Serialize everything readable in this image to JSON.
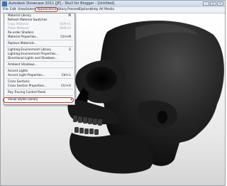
{
  "window": {
    "title": "Autodesk Showcase 2011 [JP] - Skull for Blogger - [Untitled]",
    "minimize": "–",
    "maximize": "□",
    "close": "×"
  },
  "menubar": {
    "items": [
      "File",
      "Edit",
      "View",
      "Select",
      "Appearances",
      "Story",
      "Present",
      "Options",
      "Help",
      "All Media"
    ],
    "active": "Appearances"
  },
  "dropdown": {
    "items": [
      {
        "label": "Material Library",
        "shortcut": "M",
        "disabled": false
      },
      {
        "label": "Refresh Material Swatches",
        "shortcut": "",
        "disabled": false
      },
      {
        "label": "Copy Material",
        "shortcut": "Shift+C",
        "disabled": true
      },
      {
        "label": "Paste Material",
        "shortcut": "Shift+V",
        "disabled": true
      },
      {
        "label": "Re-order Shaders",
        "shortcut": "",
        "disabled": false
      },
      {
        "label": "Material Properties...",
        "shortcut": "Ctrl+M",
        "disabled": false
      },
      {
        "label": "Replace Materials...",
        "shortcut": "",
        "disabled": false
      },
      {
        "label": "Lighting Environment Library",
        "shortcut": "E",
        "disabled": false
      },
      {
        "label": "Lighting Environment Properties...",
        "shortcut": "",
        "disabled": false
      },
      {
        "label": "Directional Lights and Shadows...",
        "shortcut": "",
        "disabled": false
      },
      {
        "label": "Ambient Shadows...",
        "shortcut": "",
        "disabled": false
      },
      {
        "label": "Accent Lights",
        "shortcut": "",
        "disabled": false
      },
      {
        "label": "Accent Light Properties...",
        "shortcut": "Ctrl+L",
        "disabled": false
      },
      {
        "label": "Cross Sections",
        "shortcut": "",
        "disabled": false
      },
      {
        "label": "Cross Section Properties...",
        "shortcut": "Ctrl+X",
        "disabled": false
      },
      {
        "label": "Ray Tracing Control Panel",
        "shortcut": "",
        "disabled": false
      },
      {
        "label": "Visual Styles Library",
        "shortcut": "",
        "disabled": false
      }
    ],
    "submenu_arrow": "▸"
  }
}
